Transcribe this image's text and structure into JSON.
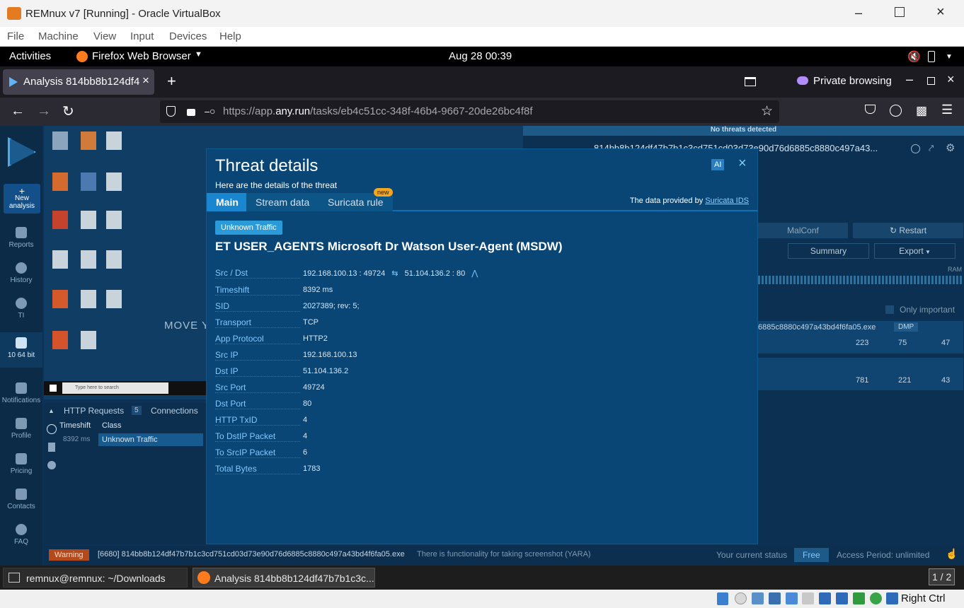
{
  "vbox": {
    "title": "REMnux v7 [Running] - Oracle VirtualBox",
    "menu": [
      "File",
      "Machine",
      "View",
      "Input",
      "Devices",
      "Help"
    ],
    "status_right": "Right Ctrl"
  },
  "gnome": {
    "activities": "Activities",
    "app": "Firefox Web Browser",
    "clock": "Aug 28  00:39"
  },
  "firefox": {
    "tab_title": "Analysis 814bb8b124df47",
    "private": "Private browsing",
    "url_prefix": "https://app.",
    "url_domain": "any.run",
    "url_path": "/tasks/eb4c51cc-348f-46b4-9667-20de26bc4f8f"
  },
  "anyrun": {
    "sidebar": [
      "New analysis",
      "Reports",
      "History",
      "TI",
      "10 64 bit",
      "Notifications",
      "Profile",
      "Pricing",
      "Contacts",
      "FAQ"
    ],
    "no_threats": "No threats detected",
    "task_hash": "814bb8b124df47b7b1c3cd751cd03d73e90d76d6885c8880c497a43...",
    "malconf": "MalConf",
    "restart": "Restart",
    "summary": "Summary",
    "export": "Export",
    "only_important": "Only important",
    "ram": "RAM",
    "proc1": "6885c8880c497a43bd4f6fa05.exe",
    "dmp": "DMP",
    "p1_stats": [
      "223",
      "75",
      "47"
    ],
    "p2_stats": [
      "781",
      "221",
      "43"
    ],
    "move_text": "MOVE Y",
    "http_tab": "HTTP Requests",
    "http_count": "5",
    "conn_tab": "Connections",
    "col_time": "Timeshift",
    "col_class": "Class",
    "row_time": "8392 ms",
    "row_class": "Unknown Traffic",
    "warning": "Warning",
    "warn_path": "[6680] 814bb8b124df47b7b1c3cd751cd03d73e90d76d6885c8880c497a43bd4f6fa05.exe",
    "warn_msg": "There is functionality for taking screenshot (YARA)",
    "status_label": "Your current status",
    "status_plan": "Free",
    "access": "Access Period: unlimited",
    "win_search": "Type here to search"
  },
  "modal": {
    "title": "Threat details",
    "subtitle": "Here are the details of the threat",
    "ai": "AI",
    "tabs": [
      "Main",
      "Stream data",
      "Suricata rule"
    ],
    "new_badge": "new",
    "provider_prefix": "The data provided by ",
    "provider_link": "Suricata IDS",
    "tag": "Unknown Traffic",
    "rule": "ET USER_AGENTS Microsoft Dr Watson User-Agent (MSDW)",
    "src_dst_src": "192.168.100.13 : 49724",
    "src_dst_dst": "51.104.136.2 : 80",
    "fields": [
      {
        "k": "Src / Dst",
        "v": ""
      },
      {
        "k": "Timeshift",
        "v": "8392 ms"
      },
      {
        "k": "SID",
        "v": "2027389; rev: 5;"
      },
      {
        "k": "Transport",
        "v": "TCP"
      },
      {
        "k": "App Protocol",
        "v": "HTTP2"
      },
      {
        "k": "Src IP",
        "v": "192.168.100.13"
      },
      {
        "k": "Dst IP",
        "v": "51.104.136.2"
      },
      {
        "k": "Src Port",
        "v": "49724"
      },
      {
        "k": "Dst Port",
        "v": "80"
      },
      {
        "k": "HTTP TxID",
        "v": "4"
      },
      {
        "k": "To DstIP Packet",
        "v": "4"
      },
      {
        "k": "To SrcIP Packet",
        "v": "6"
      },
      {
        "k": "Total Bytes",
        "v": "1783"
      }
    ]
  },
  "taskbar": {
    "terminal": "remnux@remnux: ~/Downloads",
    "firefox": "Analysis 814bb8b124df47b7b1c3c...",
    "workspace": "1 / 2"
  }
}
